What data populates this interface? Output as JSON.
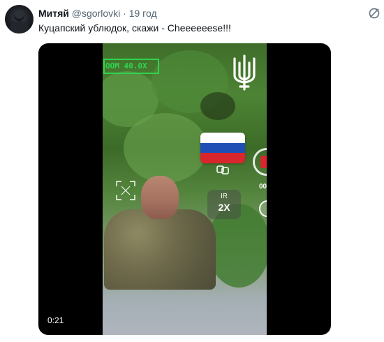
{
  "tweet": {
    "author_name": "Митяй",
    "handle": "@sgorlovki",
    "separator": "·",
    "time": "19 год",
    "text": "Куцапский ублюдок, скажи - Cheeeeeese!!!"
  },
  "media": {
    "duration": "0:21",
    "hud_zoom_text": "OOM  40.0X",
    "hud_ir": "IR",
    "hud_zoom_level": "2X",
    "hud_counter": "00",
    "flag_colors": [
      "#ffffff",
      "#1f4fb5",
      "#d8262c"
    ],
    "hud_accent": "#2fd44f"
  },
  "icons": {
    "report": "report-icon",
    "avatar": "avatar",
    "trident": "trident-emblem"
  }
}
